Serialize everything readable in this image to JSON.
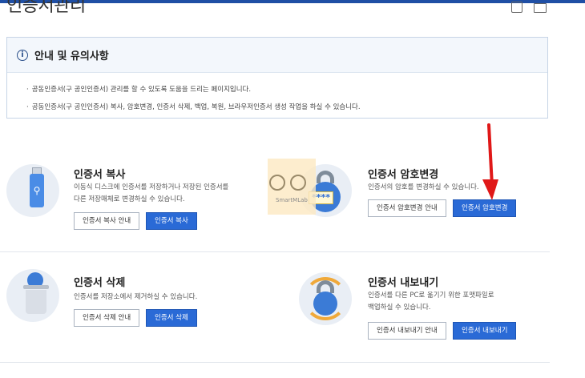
{
  "page": {
    "title": "인증서관리"
  },
  "notice": {
    "title": "안내 및 유의사항",
    "items": [
      "공동인증서(구 공인인증서) 관리를 할 수 있도록 도움을 드리는 페이지입니다.",
      "공동인증서(구 공인인증서) 복사, 암호변경, 인증서 삭제, 백업, 복원, 브라우저인증서 생성 작업을 하실 수 있습니다."
    ]
  },
  "cards": {
    "copy": {
      "title": "인증서 복사",
      "desc": [
        "이동식 디스크에 인증서를 저장하거나 저장된 인증서를",
        "다른 저장매체로 변경하실 수 있습니다."
      ],
      "guide": "인증서 복사 안내",
      "action": "인증서 복사"
    },
    "password": {
      "title": "인증서 암호변경",
      "desc": [
        "인증서의 암호를 변경하실 수 있습니다."
      ],
      "guide": "인증서 암호변경 안내",
      "action": "인증서 암호변경",
      "stars": "****"
    },
    "delete": {
      "title": "인증서 삭제",
      "desc": [
        "인증서를 저장소에서 제거하실 수 있습니다."
      ],
      "guide": "인증서 삭제 안내",
      "action": "인증서 삭제"
    },
    "export": {
      "title": "인증서 내보내기",
      "desc": [
        "인증서를 다른 PC로 옮기기 위한 포맷파일로",
        "백업하실 수 있습니다."
      ],
      "guide": "인증서 내보내기 안내",
      "action": "인증서 내보내기"
    }
  },
  "watermark": "SmartMLab",
  "colors": {
    "primary": "#2a6ad6",
    "arrow": "#e01818",
    "accent": "#1f4fa5"
  },
  "icons": [
    "info-icon",
    "usb-icon",
    "lock-icon",
    "trash-icon",
    "export-icon",
    "download-icon",
    "print-icon",
    "arrow-annotation"
  ]
}
